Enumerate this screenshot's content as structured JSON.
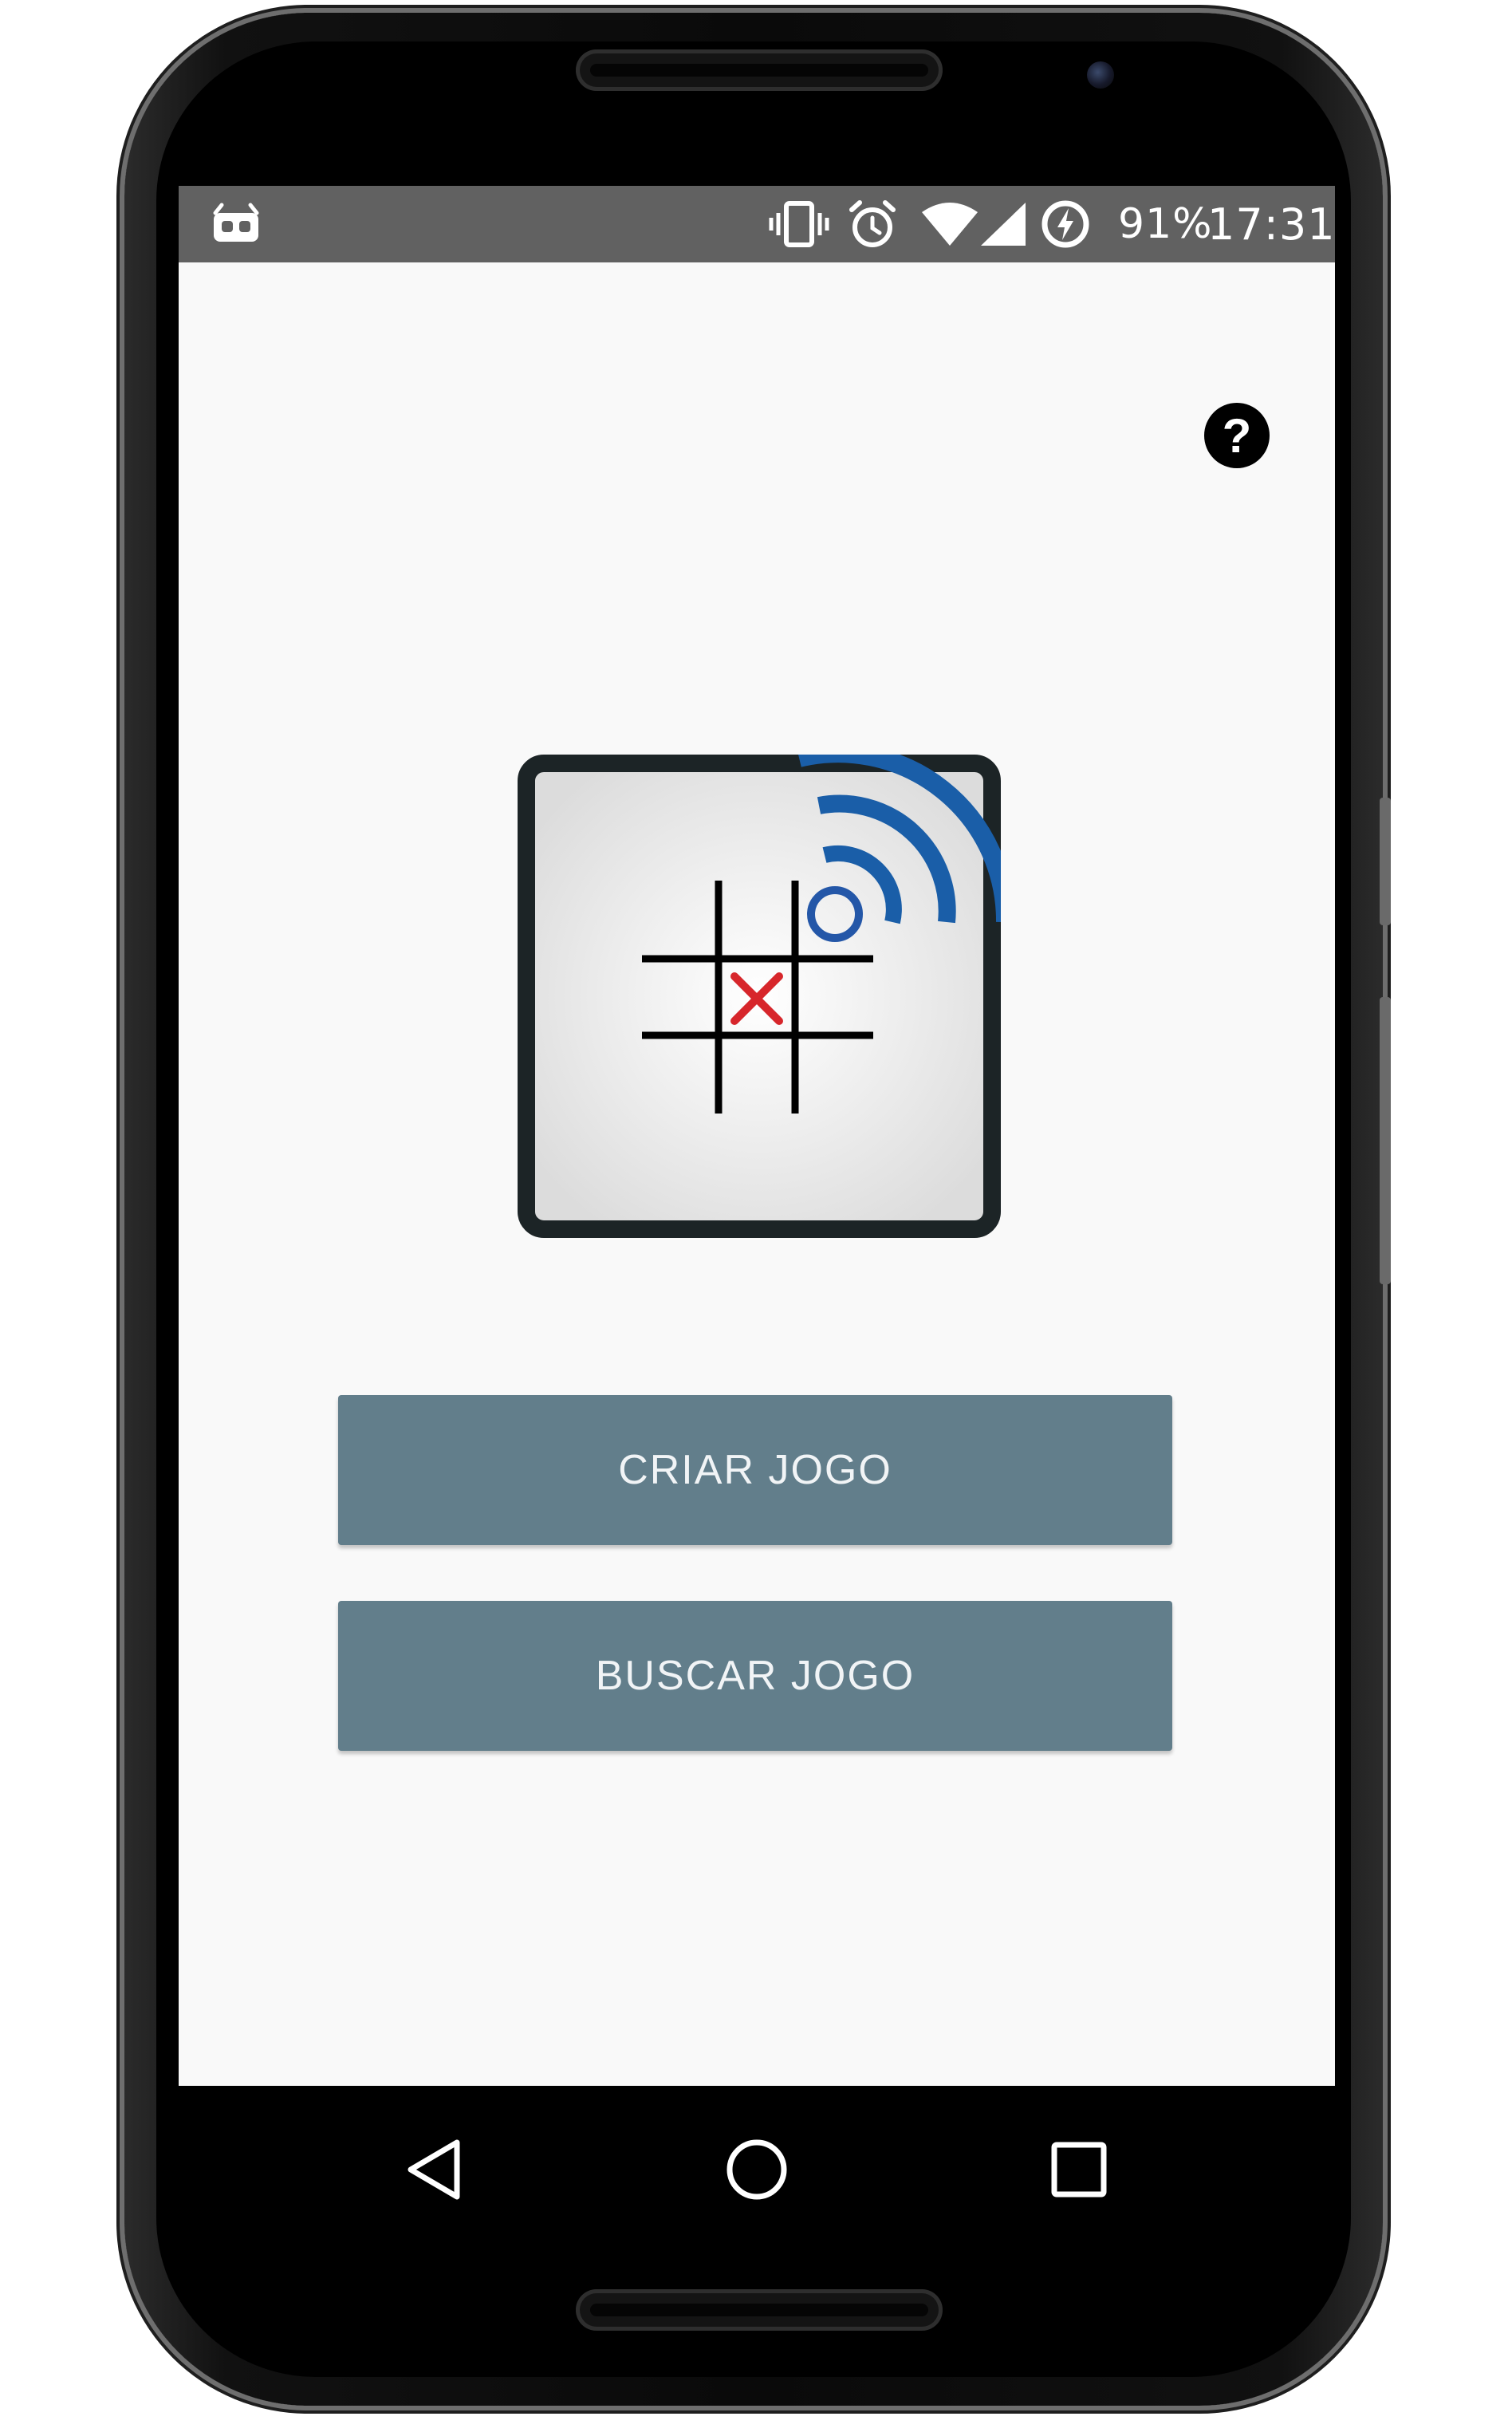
{
  "status_bar": {
    "battery_percent": "91%",
    "time": "17:31",
    "icons": [
      "android-debug-icon",
      "vibrate-icon",
      "alarm-icon",
      "wifi-icon",
      "signal-icon",
      "battery-charging-icon"
    ]
  },
  "header": {
    "help_label": "?"
  },
  "logo": {
    "icon": "tic-tac-toe-wireless-logo",
    "colors": {
      "x_mark": "#d7262b",
      "o_mark": "#2457a8",
      "wireless_arcs": "#1a5ea8",
      "frame": "#1c2426"
    }
  },
  "buttons": {
    "create_label": "CRIAR JOGO",
    "search_label": "BUSCAR JOGO",
    "color": "#627e8b"
  },
  "nav_bar": {
    "icons": [
      "back-icon",
      "home-icon",
      "recents-icon"
    ]
  }
}
